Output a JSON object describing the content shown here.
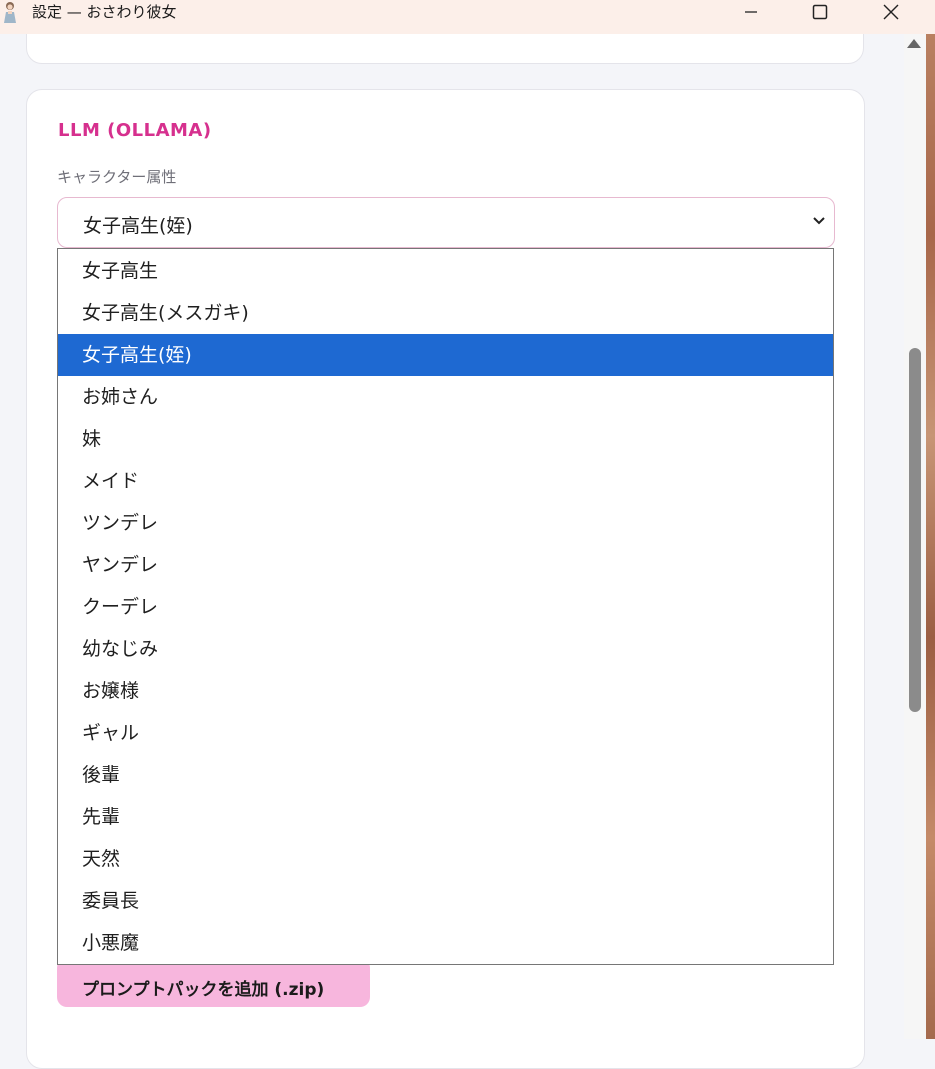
{
  "window": {
    "title": "設定 — おさわり彼女",
    "icon": "girl-figure-icon",
    "controls": {
      "minimize": "minimize-icon",
      "maximize": "maximize-icon",
      "close": "close-icon"
    }
  },
  "llm_section": {
    "title": "LLM (OLLAMA)",
    "character_attribute": {
      "label": "キャラクター属性",
      "selected_value": "女子高生(姪)",
      "options": [
        "女子高生",
        "女子高生(メスガキ)",
        "女子高生(姪)",
        "お姉さん",
        "妹",
        "メイド",
        "ツンデレ",
        "ヤンデレ",
        "クーデレ",
        "幼なじみ",
        "お嬢様",
        "ギャル",
        "後輩",
        "先輩",
        "天然",
        "委員長",
        "小悪魔"
      ],
      "highlighted_index": 2
    },
    "add_prompt_pack_label": "プロンプトパックを追加 (.zip)"
  },
  "colors": {
    "accent": "#d6308e",
    "selected_option": "#1e69d2",
    "button_pink": "#f7b6dd",
    "titlebar": "#fcefe9"
  }
}
